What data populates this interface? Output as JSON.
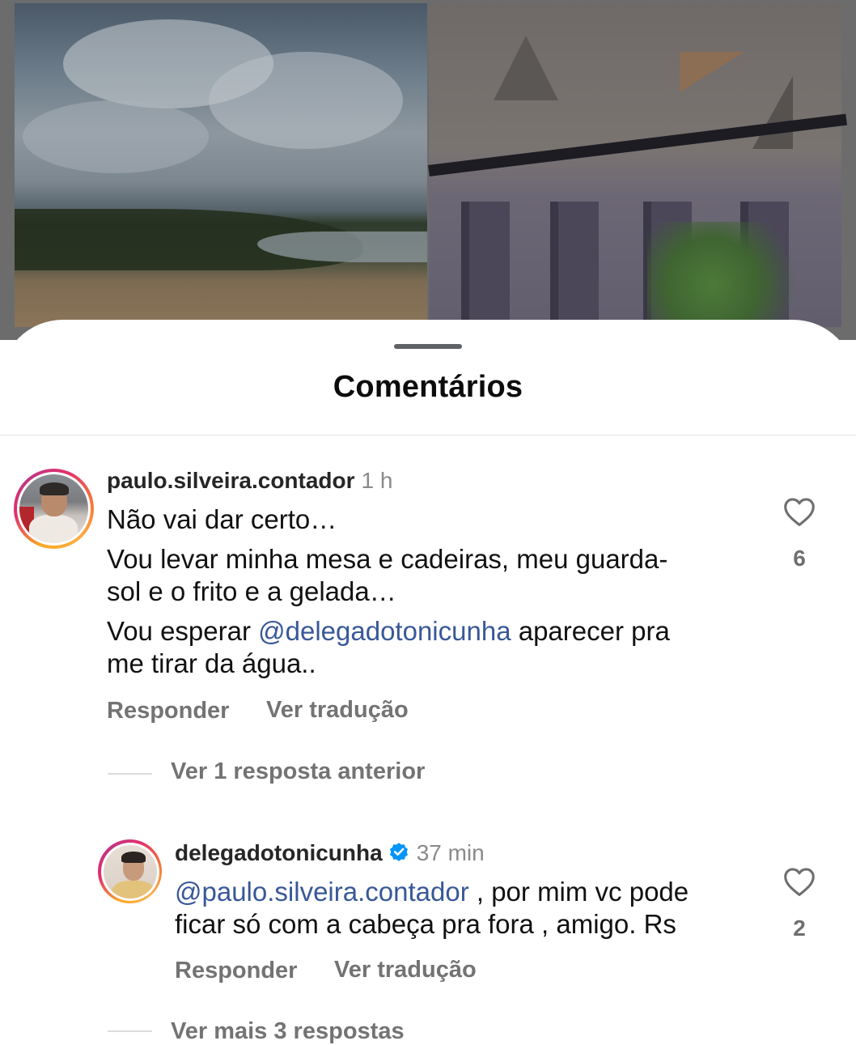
{
  "sheet": {
    "title": "Comentários"
  },
  "comments": [
    {
      "username": "paulo.silveira.contador",
      "time": "1 h",
      "lines": [
        "Não vai dar certo…",
        "Vou levar minha mesa e cadeiras, meu guarda-",
        "sol e o frito e a gelada…"
      ],
      "line3_prefix": "Vou esperar ",
      "mention": "@delegadotonicunha",
      "line3_suffix": " aparecer pra",
      "line4": "me tirar da água..",
      "likes": "6",
      "reply_label": "Responder",
      "translate_label": "Ver tradução",
      "previous_replies": "Ver 1 resposta anterior"
    },
    {
      "username": "delegadotonicunha",
      "verified": true,
      "time": "37 min",
      "mention": "@paulo.silveira.contador",
      "line1_suffix": " , por mim vc pode",
      "line2": "ficar só com a cabeça pra fora , amigo. Rs",
      "likes": "2",
      "reply_label": "Responder",
      "translate_label": "Ver tradução",
      "more_replies": "Ver mais 3 respostas"
    }
  ],
  "colors": {
    "mention": "#385898",
    "verified": "#0095f6",
    "muted": "#737373"
  },
  "icons": {
    "like": "heart-outline-icon",
    "verified": "verified-badge-icon"
  }
}
